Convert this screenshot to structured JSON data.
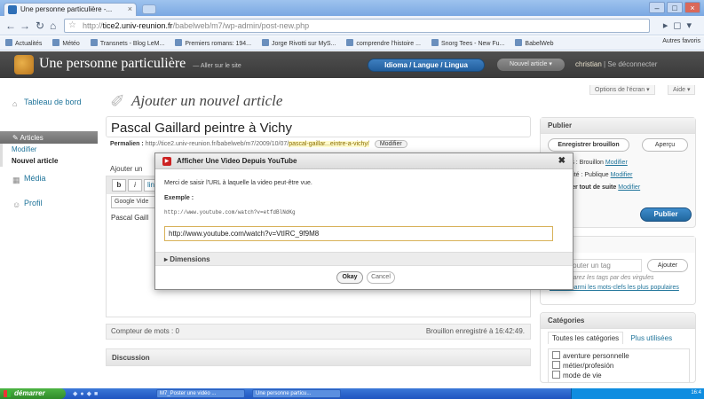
{
  "browser": {
    "tab_title": "Une personne particulière -...",
    "url_prefix": "http://",
    "url_host": "tice2.univ-reunion.fr",
    "url_path": "/babelweb/m7/wp-admin/post-new.php",
    "bookmarks": [
      "Actualités",
      "Météo",
      "Transnets - Blog LeM...",
      "Premiers romans: 194...",
      "Jorge Rivotti sur MyS...",
      "comprendre l'histoire ...",
      "Snorg Tees - New Fu...",
      "BabelWeb"
    ],
    "bookmarks_more": "Autres favoris"
  },
  "wp": {
    "site_title": "Une personne particulière",
    "visit_site": "— Aller sur le site",
    "lang_button": "Idioma / Langue / Lingua",
    "new_post_button": "Nouvel article",
    "howdy_user": "christian",
    "logout": "Se déconnecter",
    "screen_options": "Options de l'écran",
    "help": "Aide"
  },
  "menu": {
    "dashboard": "Tableau de bord",
    "articles": "Articles",
    "edit": "Modifier",
    "new_article": "Nouvel article",
    "media": "Média",
    "profile": "Profil"
  },
  "editor": {
    "heading": "Ajouter un nouvel article",
    "post_title": "Pascal Gaillard peintre à Vichy",
    "permalink_label": "Permalien :",
    "permalink_url": "http://tice2.univ-reunion.fr/babelweb/m7/2009/10/07/",
    "permalink_slug": "pascal-gaillar...eintre-a-vichy/",
    "permalink_button": "Modifier",
    "add_media": "Ajouter un",
    "fontsize_select": "Google Vide",
    "body_text": "Pascal Gaill",
    "word_count": "Compteur de mots : 0",
    "draft_saved": "Brouillon enregistré à 16:42:49.",
    "discussion": "Discussion"
  },
  "publish": {
    "title": "Publier",
    "save_draft": "Enregistrer brouillon",
    "preview": "Aperçu",
    "status_label": "Status : Brouillon",
    "status_link": "Modifier",
    "visibility_label": "Visibilité : Publique",
    "visibility_link": "Modifier",
    "schedule_label": "Publier tout de suite",
    "schedule_link": "Modifier",
    "publish_button": "Publier"
  },
  "tags": {
    "placeholder": "Ajouter un tag",
    "add_button": "Ajouter",
    "hint": "Séparez les tags par des virgules",
    "popular_link": "Choisir parmi les mots-clefs les plus populaires"
  },
  "categories": {
    "title": "Catégories",
    "tab_all": "Toutes les catégories",
    "tab_popular": "Plus utilisées",
    "items": [
      "aventure personnelle",
      "métier/profesión",
      "mode de vie"
    ]
  },
  "modal": {
    "title": "Afficher Une Video Depuis YouTube",
    "description": "Merci de saisir l'URL à laquelle la video peut-être vue.",
    "example_label": "Exemple :",
    "example_url": "http://www.youtube.com/watch?v=etfdBlNdKg",
    "input_value": "http://www.youtube.com/watch?v=VtIRC_9f9M8",
    "dimensions": "Dimensions",
    "okay": "Okay",
    "cancel": "Cancel"
  },
  "taskbar": {
    "start": "démarrer",
    "task1": "M7_Poster une vidéo ...",
    "task2": "Une personne particu...",
    "clock": "16:4"
  }
}
